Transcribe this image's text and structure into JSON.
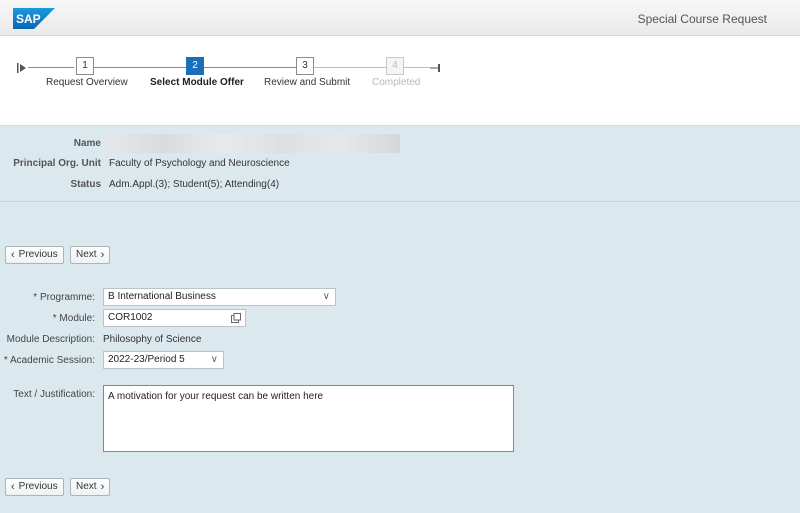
{
  "header": {
    "logo_text": "SAP",
    "app_title": "Special Course Request",
    "brand_color": "#0a78c4"
  },
  "wizard": {
    "steps": [
      {
        "number": "1",
        "label": "Request Overview",
        "state": "done"
      },
      {
        "number": "2",
        "label": "Select Module Offer",
        "state": "active"
      },
      {
        "number": "3",
        "label": "Review and Submit",
        "state": "todo"
      },
      {
        "number": "4",
        "label": "Completed",
        "state": "disabled"
      }
    ],
    "active_color": "#1b6fb8"
  },
  "info": {
    "name_label": "Name",
    "org_label": "Principal Org. Unit",
    "org_value": "Faculty of Psychology and Neuroscience",
    "status_label": "Status",
    "status_value": "Adm.Appl.(3); Student(5); Attending(4)"
  },
  "nav": {
    "previous_label": "Previous",
    "next_label": "Next"
  },
  "form": {
    "programme_label": "Programme:",
    "programme_value": "B International Business",
    "module_label": "Module:",
    "module_value": "COR1002",
    "module_desc_label": "Module Description:",
    "module_desc_value": "Philosophy of Science",
    "session_label": "Academic Session:",
    "session_value": "2022-23/Period 5",
    "justification_label": "Text / Justification:",
    "justification_value": "A motivation for your request can be written here",
    "required_marker": "*"
  }
}
